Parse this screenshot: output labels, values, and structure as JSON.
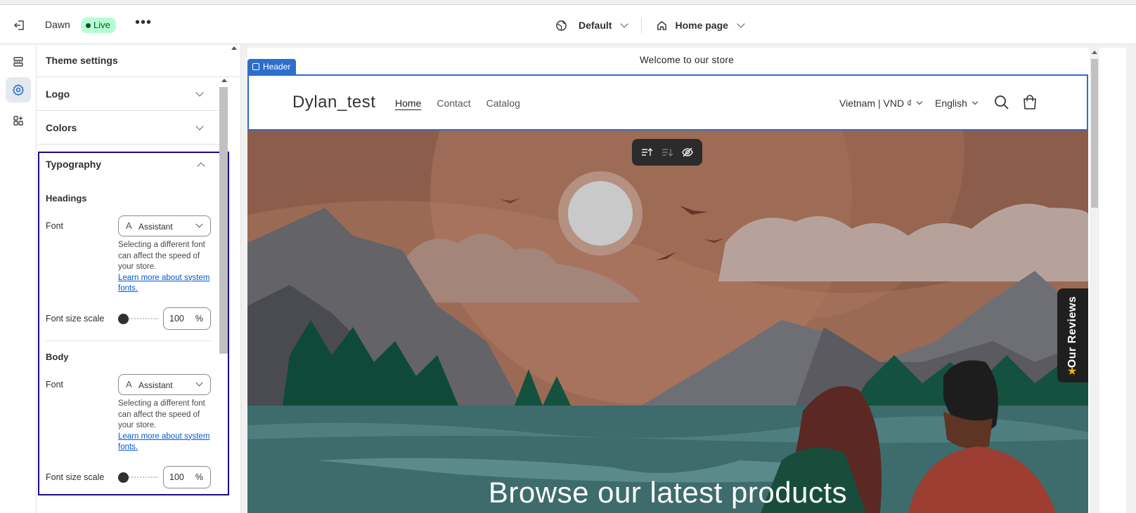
{
  "topbar": {
    "theme_name": "Dawn",
    "live_badge": "Live",
    "more_label": "•••",
    "view_select": "Default",
    "page_select": "Home page"
  },
  "panel": {
    "title": "Theme settings",
    "sections": [
      {
        "label": "Logo",
        "expanded": false
      },
      {
        "label": "Colors",
        "expanded": false
      },
      {
        "label": "Typography",
        "expanded": true
      }
    ],
    "typography": {
      "headings": {
        "label": "Headings",
        "font_label": "Font",
        "font_value": "Assistant",
        "help_text": "Selecting a different font can affect the speed of your store.",
        "help_link": "Learn more about system fonts.",
        "scale_label": "Font size scale",
        "scale_value": "100",
        "scale_unit": "%",
        "scale_fraction": 0.0
      },
      "body": {
        "label": "Body",
        "font_label": "Font",
        "font_value": "Assistant",
        "help_text": "Selecting a different font can affect the speed of your store.",
        "help_link": "Learn more about system fonts.",
        "scale_label": "Font size scale",
        "scale_value": "100",
        "scale_unit": "%",
        "scale_fraction": 0.0
      }
    }
  },
  "preview": {
    "announcement": "Welcome to our store",
    "section_tag": "Header",
    "store_name": "Dylan_test",
    "nav": [
      "Home",
      "Contact",
      "Catalog"
    ],
    "active_nav": "Home",
    "country_currency": "Vietnam | VND ₫",
    "language": "English",
    "hero_title": "Browse our latest products",
    "reviews_tab": "Our Reviews"
  },
  "colors": {
    "accent": "#2c6ecb",
    "live_bg": "#b4fed2",
    "live_fg": "#0c5132",
    "focus_outline": "#1a0a8c"
  },
  "icons": [
    "exit-icon",
    "sections-icon",
    "gear-icon",
    "apps-icon",
    "globe-icon",
    "home-icon",
    "search-icon",
    "cart-icon",
    "move-up-icon",
    "move-down-icon",
    "hide-icon",
    "star-icon"
  ]
}
